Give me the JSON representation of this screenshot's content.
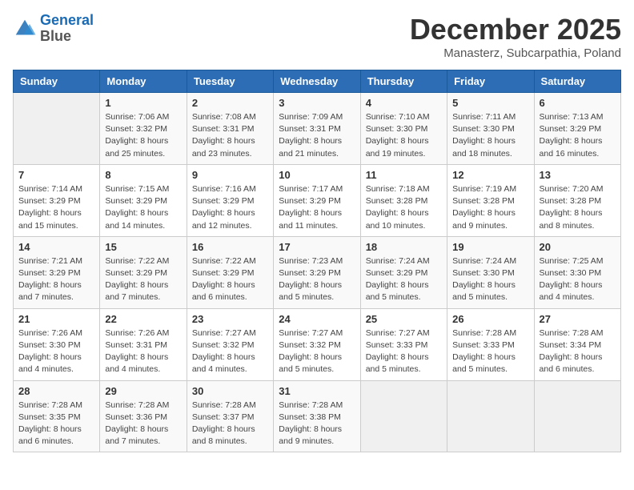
{
  "logo": {
    "line1": "General",
    "line2": "Blue"
  },
  "title": "December 2025",
  "subtitle": "Manasterz, Subcarpathia, Poland",
  "header": {
    "days": [
      "Sunday",
      "Monday",
      "Tuesday",
      "Wednesday",
      "Thursday",
      "Friday",
      "Saturday"
    ]
  },
  "weeks": [
    [
      {
        "day": "",
        "info": ""
      },
      {
        "day": "1",
        "info": "Sunrise: 7:06 AM\nSunset: 3:32 PM\nDaylight: 8 hours\nand 25 minutes."
      },
      {
        "day": "2",
        "info": "Sunrise: 7:08 AM\nSunset: 3:31 PM\nDaylight: 8 hours\nand 23 minutes."
      },
      {
        "day": "3",
        "info": "Sunrise: 7:09 AM\nSunset: 3:31 PM\nDaylight: 8 hours\nand 21 minutes."
      },
      {
        "day": "4",
        "info": "Sunrise: 7:10 AM\nSunset: 3:30 PM\nDaylight: 8 hours\nand 19 minutes."
      },
      {
        "day": "5",
        "info": "Sunrise: 7:11 AM\nSunset: 3:30 PM\nDaylight: 8 hours\nand 18 minutes."
      },
      {
        "day": "6",
        "info": "Sunrise: 7:13 AM\nSunset: 3:29 PM\nDaylight: 8 hours\nand 16 minutes."
      }
    ],
    [
      {
        "day": "7",
        "info": "Sunrise: 7:14 AM\nSunset: 3:29 PM\nDaylight: 8 hours\nand 15 minutes."
      },
      {
        "day": "8",
        "info": "Sunrise: 7:15 AM\nSunset: 3:29 PM\nDaylight: 8 hours\nand 14 minutes."
      },
      {
        "day": "9",
        "info": "Sunrise: 7:16 AM\nSunset: 3:29 PM\nDaylight: 8 hours\nand 12 minutes."
      },
      {
        "day": "10",
        "info": "Sunrise: 7:17 AM\nSunset: 3:29 PM\nDaylight: 8 hours\nand 11 minutes."
      },
      {
        "day": "11",
        "info": "Sunrise: 7:18 AM\nSunset: 3:28 PM\nDaylight: 8 hours\nand 10 minutes."
      },
      {
        "day": "12",
        "info": "Sunrise: 7:19 AM\nSunset: 3:28 PM\nDaylight: 8 hours\nand 9 minutes."
      },
      {
        "day": "13",
        "info": "Sunrise: 7:20 AM\nSunset: 3:28 PM\nDaylight: 8 hours\nand 8 minutes."
      }
    ],
    [
      {
        "day": "14",
        "info": "Sunrise: 7:21 AM\nSunset: 3:29 PM\nDaylight: 8 hours\nand 7 minutes."
      },
      {
        "day": "15",
        "info": "Sunrise: 7:22 AM\nSunset: 3:29 PM\nDaylight: 8 hours\nand 7 minutes."
      },
      {
        "day": "16",
        "info": "Sunrise: 7:22 AM\nSunset: 3:29 PM\nDaylight: 8 hours\nand 6 minutes."
      },
      {
        "day": "17",
        "info": "Sunrise: 7:23 AM\nSunset: 3:29 PM\nDaylight: 8 hours\nand 5 minutes."
      },
      {
        "day": "18",
        "info": "Sunrise: 7:24 AM\nSunset: 3:29 PM\nDaylight: 8 hours\nand 5 minutes."
      },
      {
        "day": "19",
        "info": "Sunrise: 7:24 AM\nSunset: 3:30 PM\nDaylight: 8 hours\nand 5 minutes."
      },
      {
        "day": "20",
        "info": "Sunrise: 7:25 AM\nSunset: 3:30 PM\nDaylight: 8 hours\nand 4 minutes."
      }
    ],
    [
      {
        "day": "21",
        "info": "Sunrise: 7:26 AM\nSunset: 3:30 PM\nDaylight: 8 hours\nand 4 minutes."
      },
      {
        "day": "22",
        "info": "Sunrise: 7:26 AM\nSunset: 3:31 PM\nDaylight: 8 hours\nand 4 minutes."
      },
      {
        "day": "23",
        "info": "Sunrise: 7:27 AM\nSunset: 3:32 PM\nDaylight: 8 hours\nand 4 minutes."
      },
      {
        "day": "24",
        "info": "Sunrise: 7:27 AM\nSunset: 3:32 PM\nDaylight: 8 hours\nand 5 minutes."
      },
      {
        "day": "25",
        "info": "Sunrise: 7:27 AM\nSunset: 3:33 PM\nDaylight: 8 hours\nand 5 minutes."
      },
      {
        "day": "26",
        "info": "Sunrise: 7:28 AM\nSunset: 3:33 PM\nDaylight: 8 hours\nand 5 minutes."
      },
      {
        "day": "27",
        "info": "Sunrise: 7:28 AM\nSunset: 3:34 PM\nDaylight: 8 hours\nand 6 minutes."
      }
    ],
    [
      {
        "day": "28",
        "info": "Sunrise: 7:28 AM\nSunset: 3:35 PM\nDaylight: 8 hours\nand 6 minutes."
      },
      {
        "day": "29",
        "info": "Sunrise: 7:28 AM\nSunset: 3:36 PM\nDaylight: 8 hours\nand 7 minutes."
      },
      {
        "day": "30",
        "info": "Sunrise: 7:28 AM\nSunset: 3:37 PM\nDaylight: 8 hours\nand 8 minutes."
      },
      {
        "day": "31",
        "info": "Sunrise: 7:28 AM\nSunset: 3:38 PM\nDaylight: 8 hours\nand 9 minutes."
      },
      {
        "day": "",
        "info": ""
      },
      {
        "day": "",
        "info": ""
      },
      {
        "day": "",
        "info": ""
      }
    ]
  ]
}
